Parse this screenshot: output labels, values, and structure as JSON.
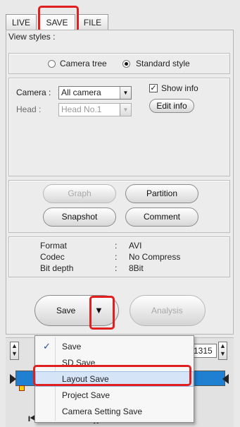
{
  "tabs": [
    "LIVE",
    "SAVE",
    "FILE"
  ],
  "view_styles": {
    "label": "View styles :",
    "options": [
      "Camera tree",
      "Standard style"
    ],
    "selected": "Standard style"
  },
  "camera": {
    "label": "Camera :",
    "value": "All camera"
  },
  "head": {
    "label": "Head :",
    "value": "Head No.1"
  },
  "show_info": {
    "label": "Show info",
    "checked": true
  },
  "edit_info_label": "Edit info",
  "buttons": {
    "graph": "Graph",
    "partition": "Partition",
    "snapshot": "Snapshot",
    "comment": "Comment",
    "save": "Save",
    "analysis": "Analysis"
  },
  "info": {
    "rows": [
      {
        "key": "Format",
        "sep": ":",
        "value": "AVI"
      },
      {
        "key": "Codec",
        "sep": ":",
        "value": "No Compress"
      },
      {
        "key": "Bit depth",
        "sep": ":",
        "value": "8Bit"
      }
    ]
  },
  "frame_value": "1315",
  "save_menu": {
    "items": [
      "Save",
      "SD Save",
      "Layout Save",
      "Project Save",
      "Camera Setting Save"
    ],
    "checked": "Save",
    "highlighted": "Layout Save"
  },
  "colors": {
    "highlight": "#e0201e",
    "timeline": "#1f7fd0",
    "menu_hover": "#d5e4f6"
  }
}
